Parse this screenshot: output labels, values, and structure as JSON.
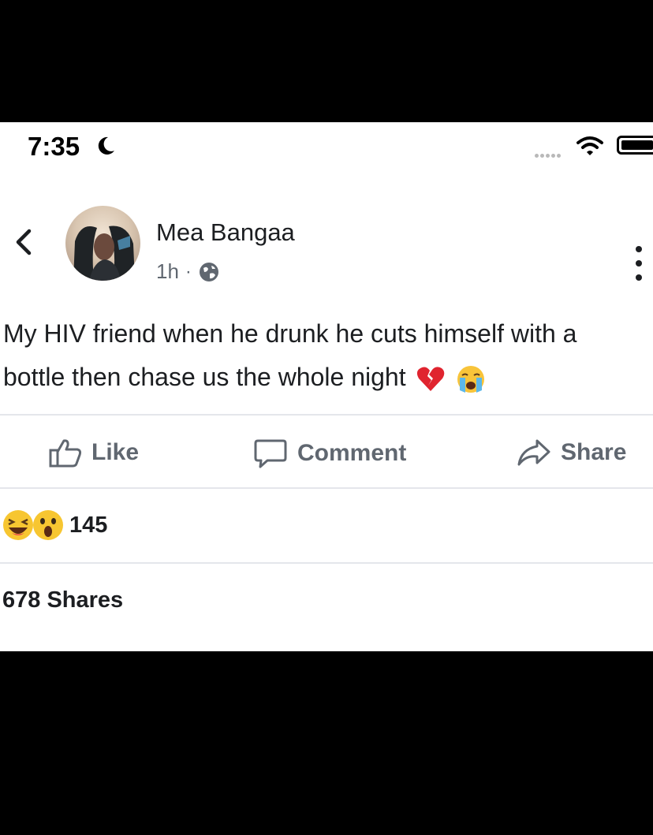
{
  "status_bar": {
    "time": "7:35"
  },
  "post": {
    "author": "Mea Bangaa",
    "time_ago": "1h",
    "separator": "·",
    "text_line1": "My HIV friend when he drunk he cuts himself with a",
    "text_line2": "bottle then chase us the whole night",
    "emojis": [
      "broken-heart-emoji",
      "crying-face-emoji"
    ]
  },
  "actions": {
    "like_label": "Like",
    "comment_label": "Comment",
    "share_label": "Share"
  },
  "reactions": {
    "icons": [
      "laughing-reaction-icon",
      "wow-reaction-icon"
    ],
    "count": "145"
  },
  "shares": {
    "label": "678 Shares"
  },
  "colors": {
    "text": "#1c1e21",
    "muted": "#606770",
    "divider": "#e4e6eb",
    "reaction_yellow": "#f7c631"
  }
}
